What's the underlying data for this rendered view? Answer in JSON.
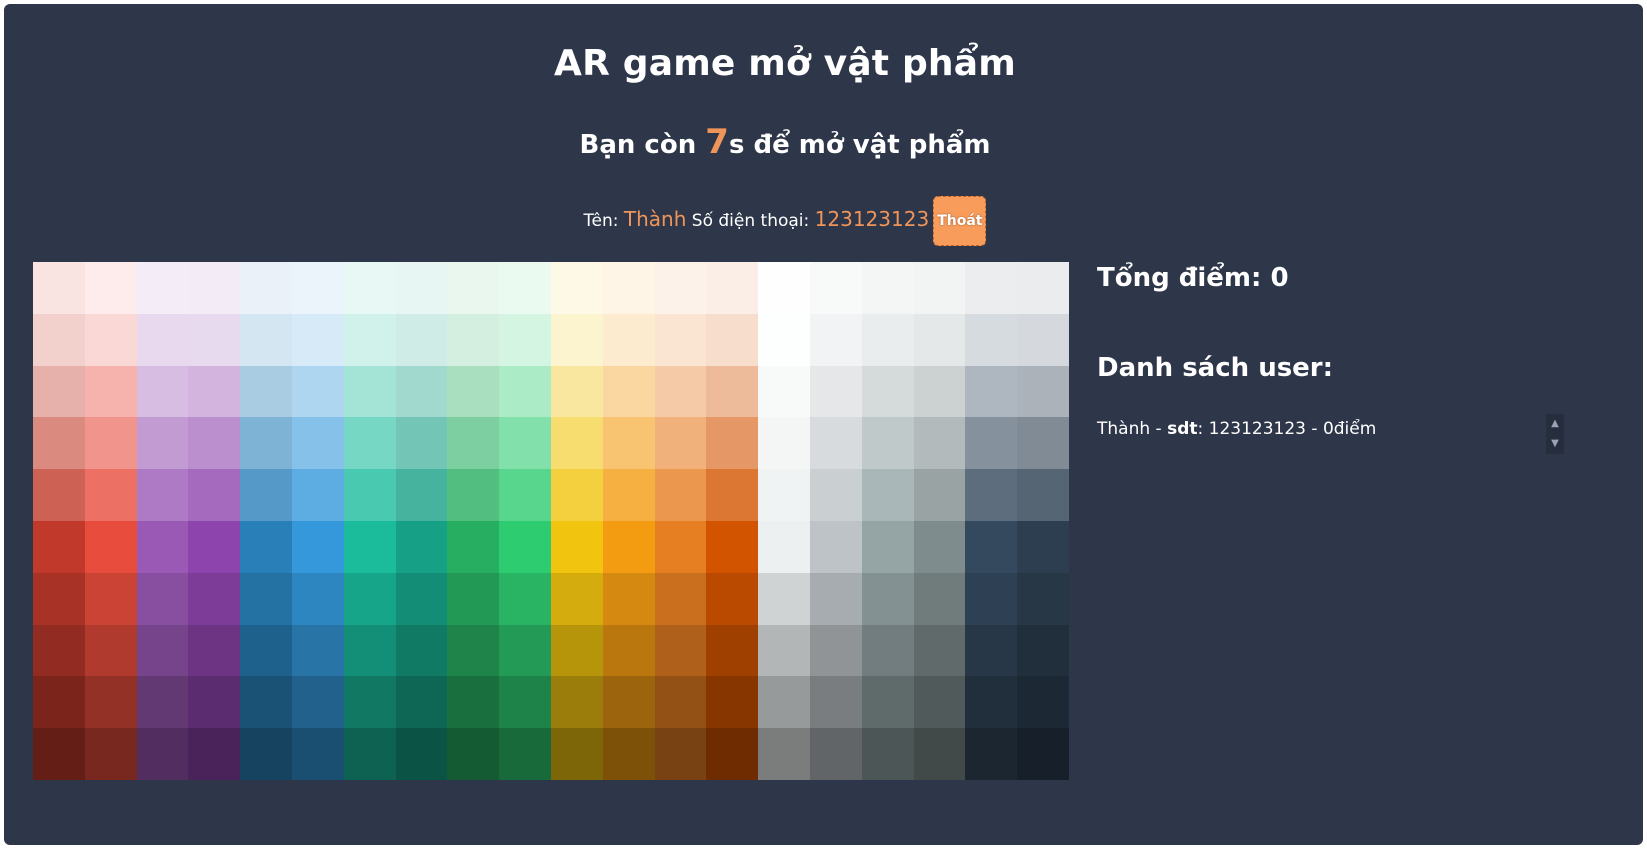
{
  "header": {
    "title": "AR game mở vật phẩm"
  },
  "timer": {
    "prefix": "Bạn còn ",
    "seconds": "7",
    "suffix": "s để mở vật phẩm"
  },
  "user": {
    "name_label": "Tên: ",
    "name": "Thành",
    "phone_label": " Số điện thoại: ",
    "phone": "123123123",
    "logout_label": "Thoát"
  },
  "score": {
    "text": "Tổng điểm: 0"
  },
  "user_list": {
    "title": "Danh sách user:",
    "items": [
      {
        "name": "Thành",
        "sep1": " - ",
        "key": "sdt",
        "sep2": ": ",
        "phone": "123123123",
        "sep3": " - ",
        "points": "0điểm"
      }
    ]
  },
  "board": {
    "columns": [
      [
        "#f9e4e2",
        "#f2d0cc",
        "#e6b1ab",
        "#db8a80",
        "#cc6154",
        "#c0392b",
        "#a93226",
        "#922b21",
        "#7b241c",
        "#641e16"
      ],
      [
        "#fdeceb",
        "#fad8d6",
        "#f6b3ae",
        "#f1958c",
        "#ec7063",
        "#e74c3c",
        "#cb4335",
        "#b03a2e",
        "#943126",
        "#78281f"
      ],
      [
        "#f4ecf7",
        "#e8d9ef",
        "#d7bde2",
        "#c39bd3",
        "#af7ac5",
        "#9b59b6",
        "#884ea0",
        "#76448a",
        "#633974",
        "#512e5f"
      ],
      [
        "#f3ebf5",
        "#e8daee",
        "#d2b4de",
        "#bb8fce",
        "#a569bd",
        "#8e44ad",
        "#7d3c98",
        "#6c3483",
        "#5b2c6f",
        "#4a235a"
      ],
      [
        "#eaf1f8",
        "#d4e6f1",
        "#a9cce3",
        "#7fb3d5",
        "#5499c7",
        "#2980b9",
        "#2471a3",
        "#1f618d",
        "#1a5276",
        "#154360"
      ],
      [
        "#ebf4fb",
        "#d6eaf8",
        "#aed6f1",
        "#85c1e9",
        "#5dade2",
        "#3498db",
        "#2e86c1",
        "#2874a6",
        "#21618c",
        "#1b4f72"
      ],
      [
        "#e8f8f5",
        "#d1f2eb",
        "#a3e4d7",
        "#76d7c4",
        "#48c9b0",
        "#1abc9c",
        "#17a589",
        "#148f77",
        "#117864",
        "#0e6251"
      ],
      [
        "#e8f6f3",
        "#d0ece7",
        "#a2d9ce",
        "#73c6b6",
        "#45b39d",
        "#16a085",
        "#138d75",
        "#117a65",
        "#0e6655",
        "#0b5345"
      ],
      [
        "#e9f7ef",
        "#d4efdf",
        "#a9dfbf",
        "#7dcea0",
        "#52be80",
        "#27ae60",
        "#229954",
        "#1e8449",
        "#196f3d",
        "#145a32"
      ],
      [
        "#eafaf1",
        "#d5f5e3",
        "#abebc6",
        "#82e0aa",
        "#58d68d",
        "#2ecc71",
        "#28b463",
        "#239b56",
        "#1d8348",
        "#186a3b"
      ],
      [
        "#fef9e7",
        "#fcf3cf",
        "#f9e79f",
        "#f7dc6f",
        "#f4d03f",
        "#f1c40f",
        "#d4ac0d",
        "#b7950b",
        "#9a7d0a",
        "#7d6608"
      ],
      [
        "#fef5e7",
        "#fdebd0",
        "#fad7a0",
        "#f8c471",
        "#f5b041",
        "#f39c12",
        "#d68910",
        "#b9770e",
        "#9c640c",
        "#7e5109"
      ],
      [
        "#fdf2e9",
        "#fae5d3",
        "#f5cba7",
        "#f0b27a",
        "#eb984e",
        "#e67e22",
        "#ca6f1e",
        "#af601a",
        "#935116",
        "#784212"
      ],
      [
        "#fbeee6",
        "#f6ddcc",
        "#edbb99",
        "#e59866",
        "#dc7633",
        "#d35400",
        "#ba4a00",
        "#a04000",
        "#873600",
        "#6e2c00"
      ],
      [
        "#fefefe",
        "#fdfefe",
        "#f8f9f9",
        "#f4f6f6",
        "#f0f3f4",
        "#ecf0f1",
        "#d0d3d4",
        "#b3b6b7",
        "#979a9a",
        "#7b7d7d"
      ],
      [
        "#f8f9f9",
        "#f2f3f4",
        "#e5e7e9",
        "#d7dbdd",
        "#cacfd2",
        "#bdc3c7",
        "#a6acaf",
        "#909497",
        "#797d7f",
        "#626567"
      ],
      [
        "#f4f6f6",
        "#eaeded",
        "#d5dbdb",
        "#bfc9ca",
        "#aab7b8",
        "#95a5a6",
        "#839192",
        "#717d7e",
        "#5f6a6a",
        "#4d5656"
      ],
      [
        "#f2f4f4",
        "#e5e8e8",
        "#ccd1d1",
        "#b2babb",
        "#99a3a4",
        "#7f8c8d",
        "#707b7c",
        "#616a6b",
        "#515a5a",
        "#424949"
      ],
      [
        "#ebedef",
        "#d6dbdf",
        "#aeb6bf",
        "#85929e",
        "#5d6d7e",
        "#34495e",
        "#2e4053",
        "#283747",
        "#212f3c",
        "#1b2631"
      ],
      [
        "#eaecee",
        "#d5d8dc",
        "#abb2b9",
        "#808b96",
        "#566573",
        "#2c3e50",
        "#273746",
        "#212f3d",
        "#1c2833",
        "#17202a"
      ]
    ]
  }
}
